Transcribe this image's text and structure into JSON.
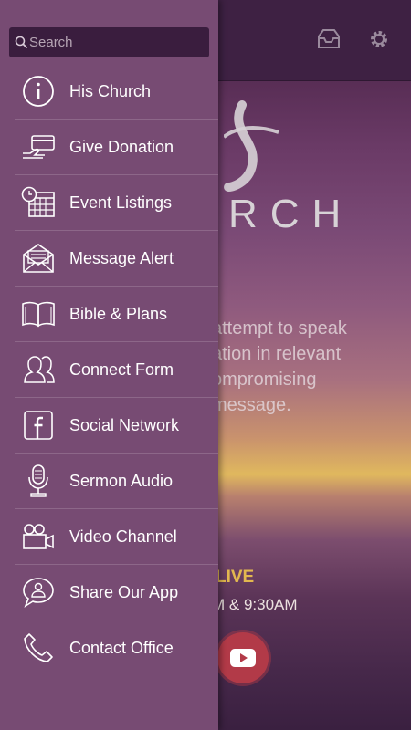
{
  "background": {
    "logo_text": "RCH",
    "copy_text": "attempt to speak\nation in relevant\nompromising\nmessage.",
    "live_text": "LIVE",
    "service_times": "M & 9:30AM"
  },
  "drawer": {
    "search_placeholder": "Search",
    "items": [
      {
        "label": "His Church",
        "icon": "info-icon"
      },
      {
        "label": "Give Donation",
        "icon": "card-payment-icon"
      },
      {
        "label": "Event Listings",
        "icon": "calendar-clock-icon"
      },
      {
        "label": "Message Alert",
        "icon": "envelope-icon"
      },
      {
        "label": "Bible & Plans",
        "icon": "book-icon"
      },
      {
        "label": "Connect Form",
        "icon": "users-icon"
      },
      {
        "label": "Social Network",
        "icon": "facebook-icon"
      },
      {
        "label": "Sermon Audio",
        "icon": "microphone-icon"
      },
      {
        "label": "Video Channel",
        "icon": "video-camera-icon"
      },
      {
        "label": "Share Our App",
        "icon": "share-chat-icon"
      },
      {
        "label": "Contact Office",
        "icon": "phone-icon"
      }
    ]
  },
  "colors": {
    "drawer_bg": "#774b73",
    "search_bg": "#3a1d3e",
    "accent_live": "#e2b84f"
  }
}
